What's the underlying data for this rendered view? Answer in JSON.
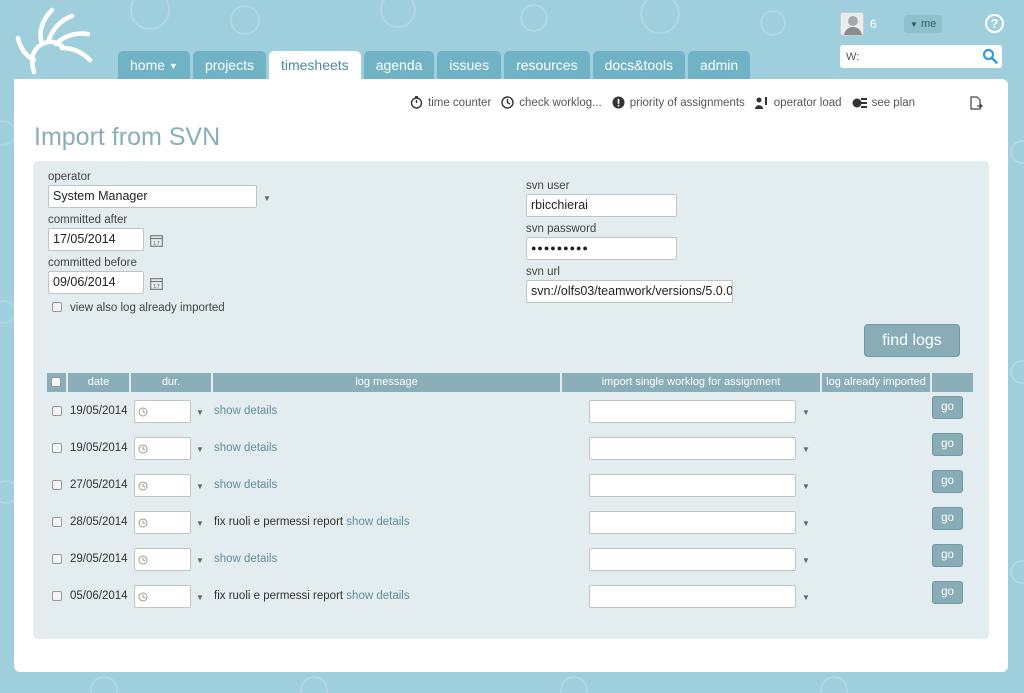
{
  "header": {
    "user_count": "6",
    "me_label": "me",
    "search_value": "W:"
  },
  "nav": {
    "tabs": [
      {
        "label": "home",
        "active": false,
        "has_menu": true
      },
      {
        "label": "projects",
        "active": false
      },
      {
        "label": "timesheets",
        "active": true
      },
      {
        "label": "agenda",
        "active": false
      },
      {
        "label": "issues",
        "active": false
      },
      {
        "label": "resources",
        "active": false
      },
      {
        "label": "docs&tools",
        "active": false
      },
      {
        "label": "admin",
        "active": false
      }
    ]
  },
  "toolbar": {
    "time_counter": "time counter",
    "check_worklog": "check worklog...",
    "priority": "priority of assignments",
    "operator_load": "operator load",
    "see_plan": "see plan"
  },
  "page": {
    "title": "Import from SVN"
  },
  "form": {
    "operator_label": "operator",
    "operator_value": "System Manager",
    "committed_after_label": "committed after",
    "committed_after_value": "17/05/2014",
    "committed_before_label": "committed before",
    "committed_before_value": "09/06/2014",
    "view_also_label": "view also log already imported",
    "svn_user_label": "svn user",
    "svn_user_value": "rbicchierai",
    "svn_password_label": "svn password",
    "svn_password_value": "●●●●●●●●●",
    "svn_url_label": "svn url",
    "svn_url_value": "svn://olfs03/teamwork/versions/5.0.0",
    "find_button": "find logs"
  },
  "table": {
    "headers": {
      "date": "date",
      "dur": "dur.",
      "log_message": "log message",
      "import": "import single worklog for assignment",
      "already": "log already imported"
    },
    "go_label": "go",
    "rows": [
      {
        "date": "19/05/2014",
        "message": "",
        "link": "show details"
      },
      {
        "date": "19/05/2014",
        "message": "",
        "link": "show details"
      },
      {
        "date": "27/05/2014",
        "message": "",
        "link": "show details"
      },
      {
        "date": "28/05/2014",
        "message": "fix ruoli e permessi report ",
        "link": "show details"
      },
      {
        "date": "29/05/2014",
        "message": "",
        "link": "show details"
      },
      {
        "date": "05/06/2014",
        "message": "fix ruoli e permessi report ",
        "link": "show details"
      }
    ]
  },
  "colors": {
    "background": "#9fcfdc",
    "nav_tab": "#6fb3c4",
    "accent": "#88adb6",
    "title": "#8aaeb8",
    "form_bg": "#e3ecee"
  }
}
